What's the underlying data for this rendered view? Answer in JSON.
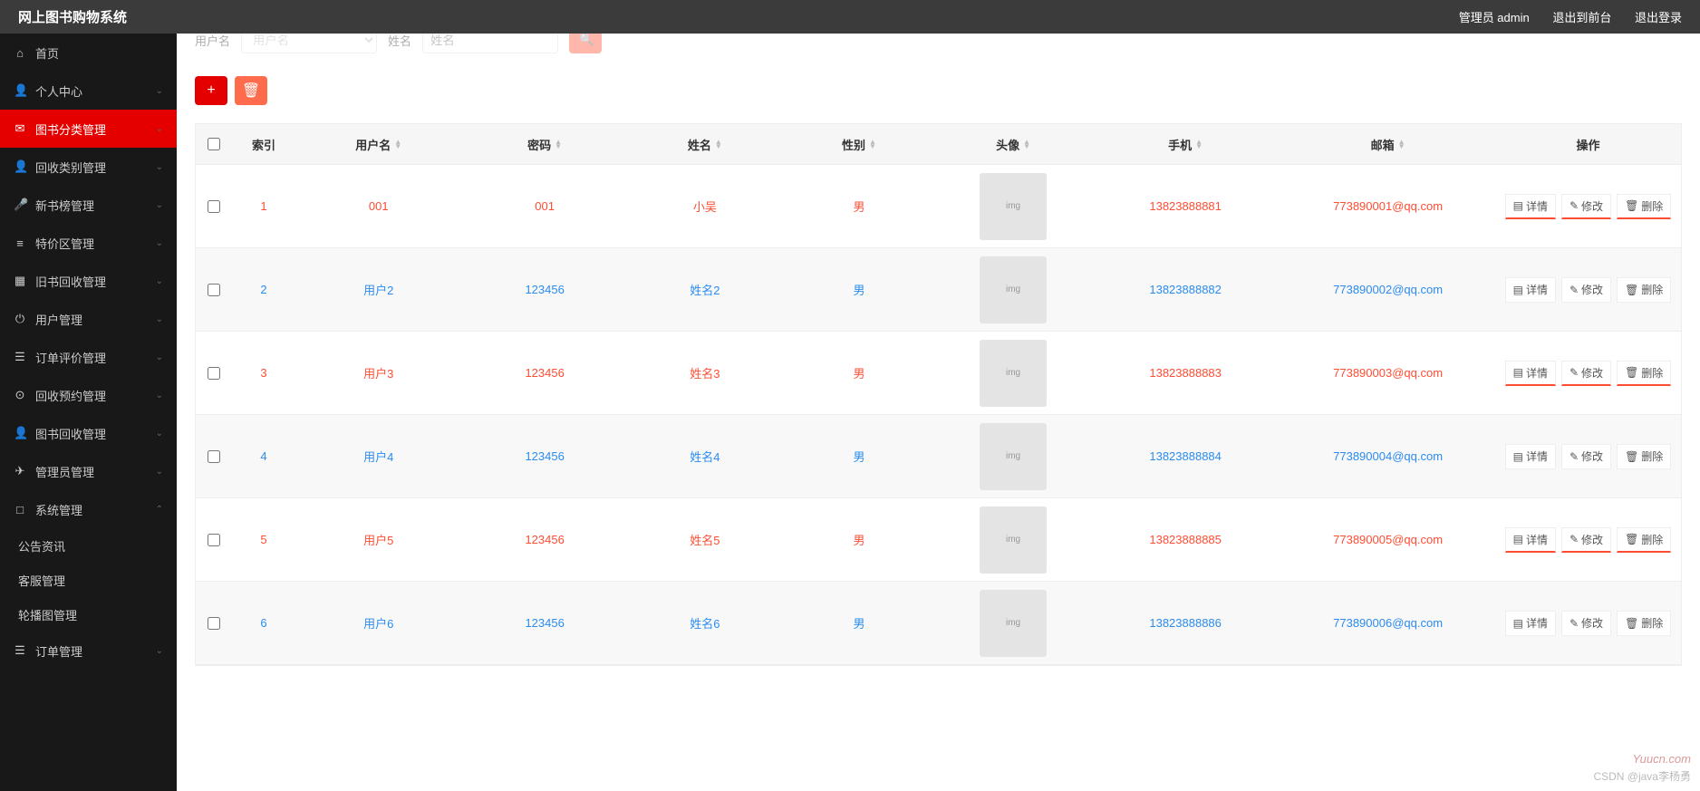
{
  "header": {
    "title": "网上图书购物系统",
    "admin_label": "管理员 admin",
    "back_front": "退出到前台",
    "logout": "退出登录"
  },
  "sidebar": {
    "items": [
      {
        "icon": "⌂",
        "label": "首页",
        "expandable": false
      },
      {
        "icon": "👤",
        "label": "个人中心",
        "expandable": true
      },
      {
        "icon": "✉",
        "label": "图书分类管理",
        "expandable": true,
        "active": true
      },
      {
        "icon": "👤",
        "label": "回收类别管理",
        "expandable": true
      },
      {
        "icon": "🎤",
        "label": "新书榜管理",
        "expandable": true
      },
      {
        "icon": "≡",
        "label": "特价区管理",
        "expandable": true
      },
      {
        "icon": "▦",
        "label": "旧书回收管理",
        "expandable": true
      },
      {
        "icon": "⏻",
        "label": "用户管理",
        "expandable": true
      },
      {
        "icon": "☰",
        "label": "订单评价管理",
        "expandable": true
      },
      {
        "icon": "⊙",
        "label": "回收预约管理",
        "expandable": true
      },
      {
        "icon": "👤",
        "label": "图书回收管理",
        "expandable": true
      },
      {
        "icon": "✈",
        "label": "管理员管理",
        "expandable": true
      },
      {
        "icon": "□",
        "label": "系统管理",
        "expandable": true,
        "expanded": true
      },
      {
        "icon": "☰",
        "label": "订单管理",
        "expandable": true
      }
    ],
    "subs": [
      "公告资讯",
      "客服管理",
      "轮播图管理"
    ]
  },
  "filter": {
    "label1": "用户名",
    "placeholder1": "用户名",
    "label2": "姓名",
    "placeholder2": "姓名"
  },
  "table": {
    "headers": [
      "索引",
      "用户名",
      "密码",
      "姓名",
      "性别",
      "头像",
      "手机",
      "邮箱",
      "操作"
    ],
    "rows": [
      {
        "idx": "1",
        "user": "001",
        "pwd": "001",
        "name": "小吴",
        "sex": "男",
        "phone": "13823888881",
        "email": "773890001@qq.com",
        "cls": "red"
      },
      {
        "idx": "2",
        "user": "用户2",
        "pwd": "123456",
        "name": "姓名2",
        "sex": "男",
        "phone": "13823888882",
        "email": "773890002@qq.com",
        "cls": "blue"
      },
      {
        "idx": "3",
        "user": "用户3",
        "pwd": "123456",
        "name": "姓名3",
        "sex": "男",
        "phone": "13823888883",
        "email": "773890003@qq.com",
        "cls": "red"
      },
      {
        "idx": "4",
        "user": "用户4",
        "pwd": "123456",
        "name": "姓名4",
        "sex": "男",
        "phone": "13823888884",
        "email": "773890004@qq.com",
        "cls": "blue"
      },
      {
        "idx": "5",
        "user": "用户5",
        "pwd": "123456",
        "name": "姓名5",
        "sex": "男",
        "phone": "13823888885",
        "email": "773890005@qq.com",
        "cls": "red"
      },
      {
        "idx": "6",
        "user": "用户6",
        "pwd": "123456",
        "name": "姓名6",
        "sex": "男",
        "phone": "13823888886",
        "email": "773890006@qq.com",
        "cls": "blue"
      }
    ],
    "ops": {
      "detail": "详情",
      "edit": "修改",
      "delete": "删除"
    }
  },
  "watermark": {
    "line1": "Yuucn.com",
    "line2": "CSDN @java李杨勇"
  }
}
